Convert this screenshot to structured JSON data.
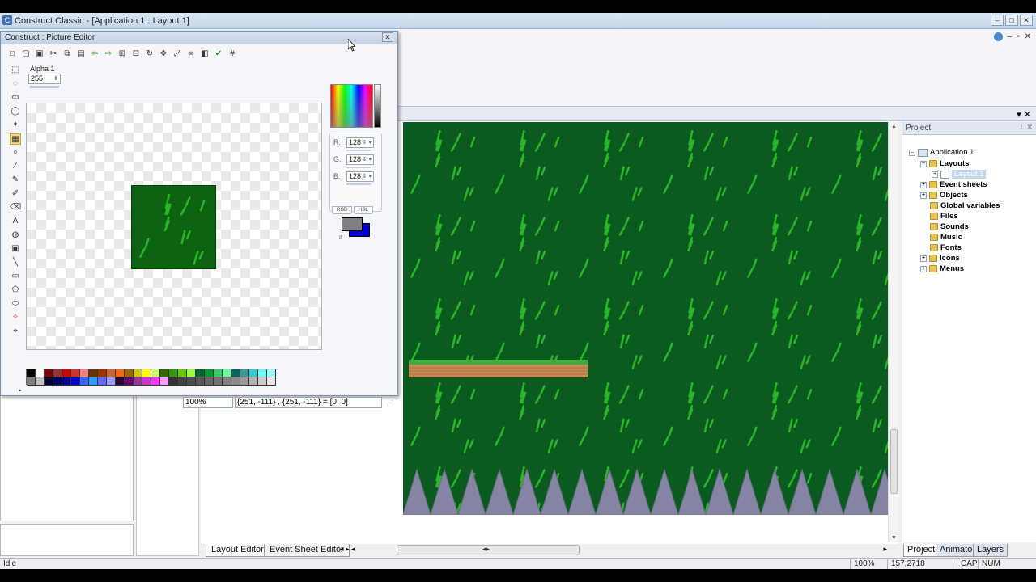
{
  "window": {
    "title": "Construct Classic - [Application 1 : Layout 1]"
  },
  "picture_editor": {
    "title": "Construct : Picture Editor",
    "close_label": "✕",
    "alpha_label": "Alpha 1",
    "alpha_value": "255",
    "color": {
      "r_label": "R:",
      "r_value": "128",
      "g_label": "G:",
      "g_value": "128",
      "b_label": "B:",
      "b_value": "128",
      "tab_rgb": "RGB",
      "tab_hsl": "HSL",
      "foreground": "#808080",
      "background": "#0000cc"
    },
    "zoom": "100%",
    "coords": "{251, -111} , {251, -111} = [0, 0]",
    "palette_row1": [
      "#000000",
      "#ffffff",
      "#7f0000",
      "#993333",
      "#cc0000",
      "#cc3333",
      "#ff8080",
      "#663300",
      "#993300",
      "#cc6633",
      "#ff6600",
      "#996600",
      "#cccc00",
      "#ffff00",
      "#ccff66",
      "#336600",
      "#339900",
      "#66cc00",
      "#99ff33",
      "#006633",
      "#009933",
      "#33cc66",
      "#66ff99",
      "#006666",
      "#339999",
      "#33cccc",
      "#66ffff",
      "#99ffff"
    ],
    "palette_row2": [
      "#808080",
      "#c0c0c0",
      "#000033",
      "#000066",
      "#000099",
      "#0000cc",
      "#3366ff",
      "#3399ff",
      "#6666ff",
      "#9999ff",
      "#330033",
      "#660066",
      "#993399",
      "#cc33cc",
      "#ff33ff",
      "#ff99ff",
      "#333333",
      "#404040",
      "#4d4d4d",
      "#595959",
      "#666666",
      "#737373",
      "#808080",
      "#8c8c8c",
      "#999999",
      "#b3b3b3",
      "#cccccc",
      "#e6e6e6"
    ]
  },
  "tabs": {
    "layout_editor": "Layout Editor",
    "event_sheet_editor": "Event Sheet Editor"
  },
  "project": {
    "header": "Project",
    "root": "Application 1",
    "items": [
      {
        "label": "Layouts"
      },
      {
        "label": "Layout 1"
      },
      {
        "label": "Event sheets"
      },
      {
        "label": "Objects"
      },
      {
        "label": "Global variables"
      },
      {
        "label": "Files"
      },
      {
        "label": "Sounds"
      },
      {
        "label": "Music"
      },
      {
        "label": "Fonts"
      },
      {
        "label": "Icons"
      },
      {
        "label": "Menus"
      }
    ],
    "tabs": [
      "Project",
      "Animator",
      "Layers"
    ]
  },
  "status": {
    "left": "Idle",
    "zoom": "100%",
    "coords": "157,2718",
    "cap": "CAP",
    "num": "NUM"
  },
  "colors": {
    "canvas_bg": "#0b5a1f",
    "grass_stroke": "#2bb52b",
    "spike_fill": "#8585a3",
    "platform_top": "#3fae3f",
    "platform_body": "#c98a5a"
  }
}
